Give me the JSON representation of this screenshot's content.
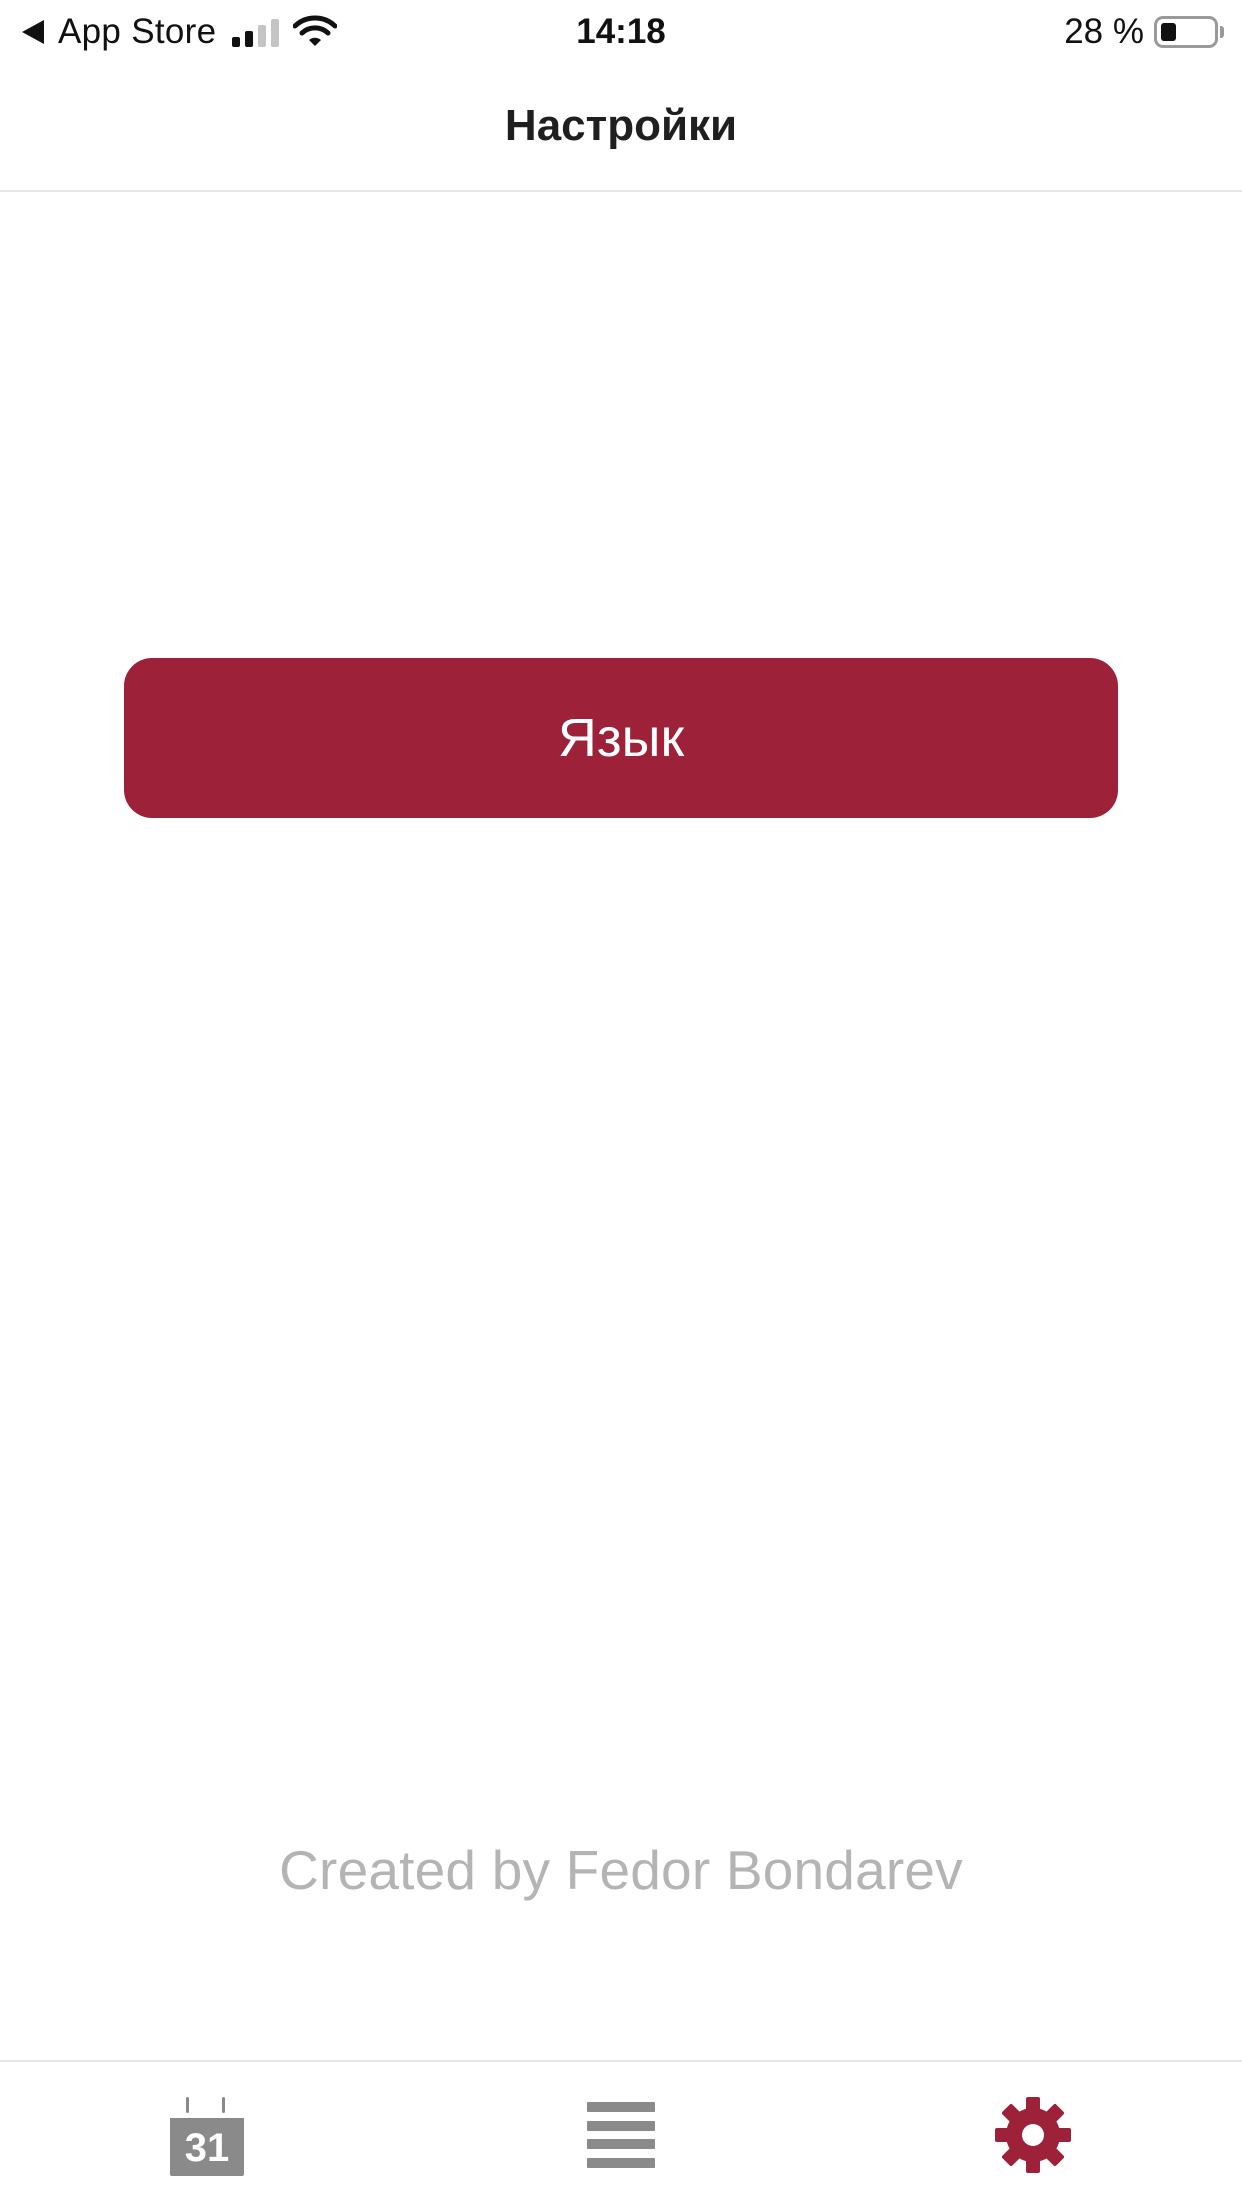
{
  "status_bar": {
    "back_label": "App Store",
    "time": "14:18",
    "battery_text": "28 %",
    "battery_level": 0.28,
    "signal_bars_active": 2,
    "signal_bars_total": 4
  },
  "nav": {
    "title": "Настройки"
  },
  "main": {
    "language_button_label": "Язык",
    "credit": "Created by Fedor Bondarev"
  },
  "tab_bar": {
    "items": [
      {
        "icon": "calendar-icon",
        "text": "31",
        "active": false
      },
      {
        "icon": "list-icon",
        "active": false
      },
      {
        "icon": "gear-icon",
        "active": true
      }
    ],
    "active_color": "#9c2139",
    "inactive_color": "#8a8a8a"
  },
  "colors": {
    "accent": "#9c2139",
    "credit_text": "#b4b4b4",
    "title_text": "#1f1f1f"
  }
}
